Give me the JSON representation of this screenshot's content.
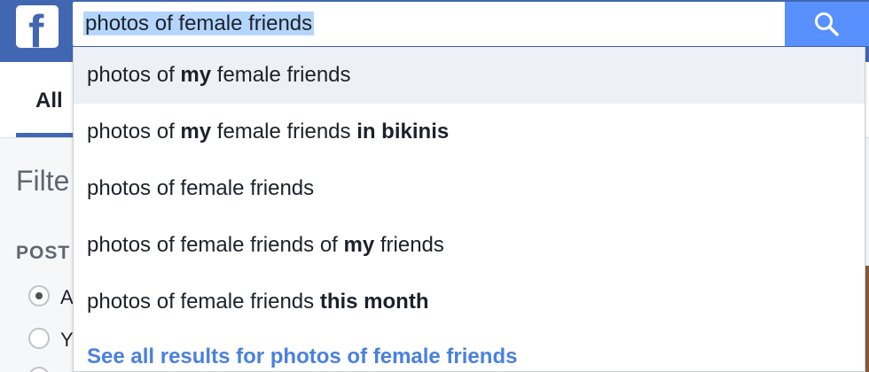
{
  "search": {
    "query": "photos of female friends",
    "icon": "search-icon"
  },
  "logo": {
    "letter": "f",
    "icon": "facebook-logo-icon"
  },
  "tabs": {
    "active_label": "All"
  },
  "filters": {
    "title": "Filte",
    "posts_label": "POST",
    "options": [
      {
        "label": "A",
        "checked": true
      },
      {
        "label": "Y",
        "checked": false
      }
    ]
  },
  "suggestions": [
    {
      "parts": [
        {
          "t": "photos of ",
          "b": false
        },
        {
          "t": "my",
          "b": true
        },
        {
          "t": " female friends",
          "b": false
        }
      ],
      "active": true
    },
    {
      "parts": [
        {
          "t": "photos of ",
          "b": false
        },
        {
          "t": "my",
          "b": true
        },
        {
          "t": " female friends ",
          "b": false
        },
        {
          "t": "in bikinis",
          "b": true
        }
      ],
      "active": false
    },
    {
      "parts": [
        {
          "t": "photos of female friends",
          "b": false
        }
      ],
      "active": false
    },
    {
      "parts": [
        {
          "t": "photos of female friends of ",
          "b": false
        },
        {
          "t": "my",
          "b": true
        },
        {
          "t": " friends",
          "b": false
        }
      ],
      "active": false
    },
    {
      "parts": [
        {
          "t": "photos of female friends ",
          "b": false
        },
        {
          "t": "this month",
          "b": true
        }
      ],
      "active": false
    }
  ],
  "see_all": "See all results for photos of female friends",
  "colors": {
    "brand_blue": "#4267b2",
    "search_button": "#5890ff",
    "link_blue": "#4a80e0",
    "selection": "#b4d5fe",
    "active_row": "#edf0f6"
  }
}
